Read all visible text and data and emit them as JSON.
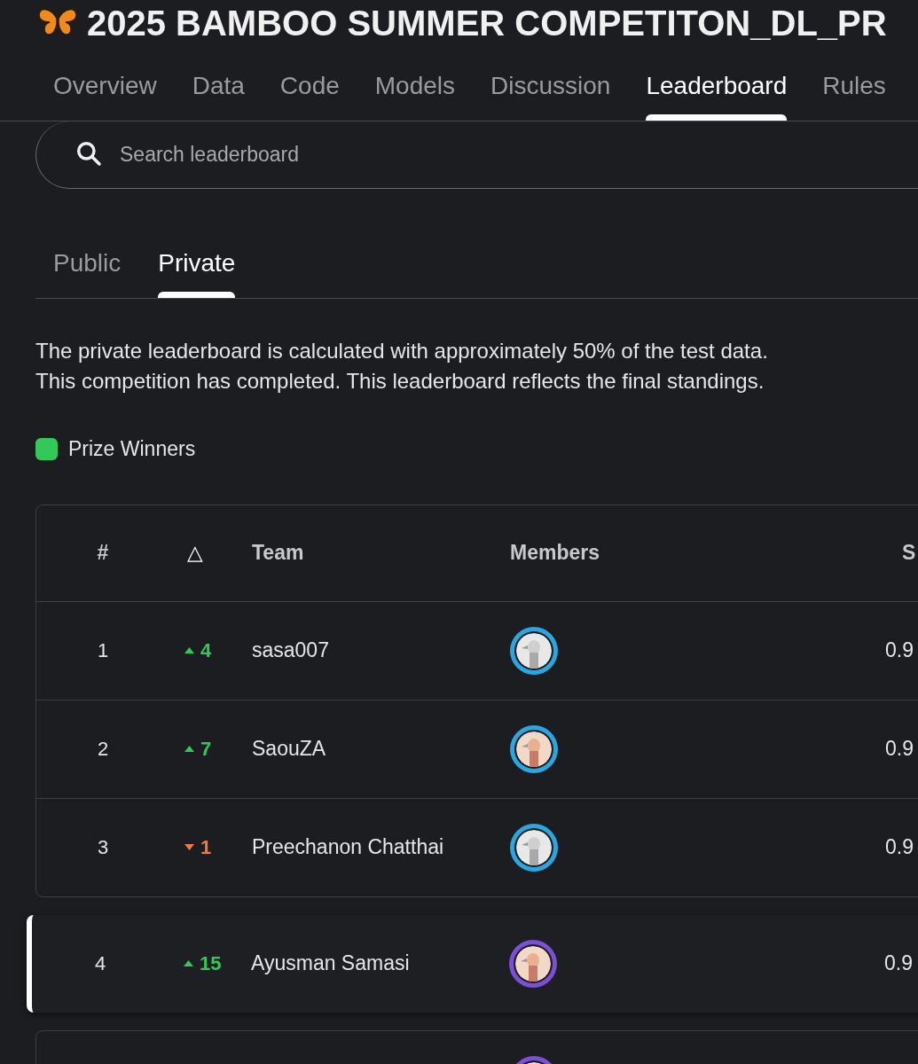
{
  "title": "2025 BAMBOO SUMMER COMPETITON_DL_PR",
  "tabs": [
    {
      "label": "Overview",
      "selected": false
    },
    {
      "label": "Data",
      "selected": false
    },
    {
      "label": "Code",
      "selected": false
    },
    {
      "label": "Models",
      "selected": false
    },
    {
      "label": "Discussion",
      "selected": false
    },
    {
      "label": "Leaderboard",
      "selected": true
    },
    {
      "label": "Rules",
      "selected": false
    }
  ],
  "search": {
    "placeholder": "Search leaderboard"
  },
  "board_tabs": [
    {
      "label": "Public",
      "selected": false
    },
    {
      "label": "Private",
      "selected": true
    }
  ],
  "description": [
    "The private leaderboard is calculated with approximately 50% of the test data.",
    "This competition has completed. This leaderboard reflects the final standings."
  ],
  "legend": {
    "label": "Prize Winners",
    "color": "#34c759"
  },
  "table": {
    "columns": [
      "#",
      "△",
      "Team",
      "Members",
      "S"
    ],
    "rows": [
      {
        "rank": "1",
        "delta": {
          "kind": "up",
          "value": "4"
        },
        "team": "sasa007",
        "members": [
          {
            "color": "#2aa7e0"
          }
        ],
        "score": "0.9",
        "highlighted": false
      },
      {
        "rank": "2",
        "delta": {
          "kind": "up",
          "value": "7"
        },
        "team": "SaouZA",
        "members": [
          {
            "color": "#2aa7e0"
          }
        ],
        "score": "0.9",
        "highlighted": false
      },
      {
        "rank": "3",
        "delta": {
          "kind": "down",
          "value": "1"
        },
        "team": "Preechanon Chatthai",
        "members": [
          {
            "color": "#2aa7e0"
          }
        ],
        "score": "0.9",
        "highlighted": false
      },
      {
        "rank": "4",
        "delta": {
          "kind": "up",
          "value": "15"
        },
        "team": "Ayusman Samasi",
        "members": [
          {
            "color": "#7b4fd6"
          }
        ],
        "score": "0.9",
        "highlighted": true
      }
    ],
    "partial_row": {
      "members": [
        {
          "color": "#7b4fd6"
        }
      ]
    }
  }
}
